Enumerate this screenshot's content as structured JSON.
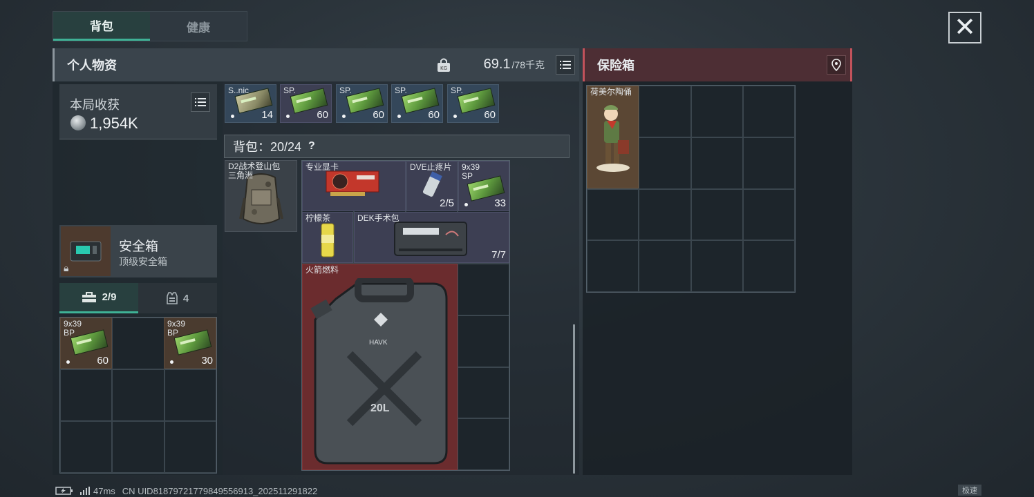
{
  "tabs": [
    {
      "label": "背包"
    },
    {
      "label": "健康"
    }
  ],
  "personal": {
    "title": "个人物资",
    "weight_value": "69.1",
    "weight_max": "/78千克",
    "harvest_label": "本局收获",
    "harvest_value": "1,954K",
    "safebox_title": "安全箱",
    "safebox_sub": "顶级安全箱",
    "subtabs": [
      {
        "label": "2/9"
      },
      {
        "label": "4"
      }
    ]
  },
  "pocket_items": [
    {
      "name": "9x39\nBP",
      "qty": "60"
    },
    {
      "name": "9x39\nBP",
      "qty": "30"
    }
  ],
  "top_ammo": [
    {
      "name": "S..nic",
      "qty": "14"
    },
    {
      "name": "SP.",
      "qty": "60"
    },
    {
      "name": "SP.",
      "qty": "60"
    },
    {
      "name": "SP.",
      "qty": "60"
    },
    {
      "name": "SP.",
      "qty": "60"
    }
  ],
  "backpack": {
    "label": "背包：20/24",
    "help": "?",
    "bag_item_name": "D2战术登山包\n三角洲",
    "items": [
      {
        "name": "专业显卡",
        "qty": ""
      },
      {
        "name": "DVE止疼片",
        "qty": "2/5"
      },
      {
        "name": "9x39\nSP",
        "qty": "33"
      },
      {
        "name": "柠檬茶",
        "qty": ""
      },
      {
        "name": "DEK手术包",
        "qty": "7/7"
      },
      {
        "name": "火箭燃料",
        "qty": ""
      }
    ],
    "fuel_can_text": "20L",
    "fuel_brand": "HAVK"
  },
  "safe": {
    "title": "保险箱",
    "item_name": "荷美尔陶俑"
  },
  "status": {
    "ping": "47ms",
    "uid": "CN UID818797217798495569​13_202511291822"
  },
  "speed_label": "极速",
  "colors": {
    "accent": "#3fb296",
    "safe_border": "#c2525b"
  }
}
